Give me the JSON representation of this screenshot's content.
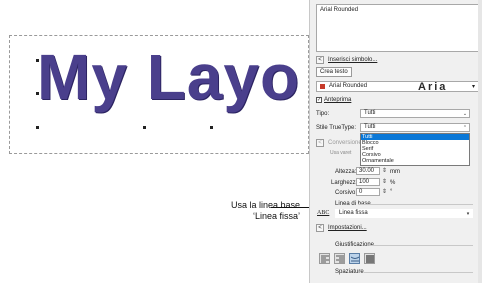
{
  "canvas": {
    "design_text": "My Layo"
  },
  "callout": {
    "line1": "Usa la linea base",
    "line2": "‘Linea fissa’"
  },
  "panel": {
    "text_value": "Arial Rounded",
    "insert_symbol": "Inserisci simbolo...",
    "create_text": "Crea testo",
    "font_name": "Arial Rounded",
    "font_preview": "Aria",
    "preview_label": "Anteprima",
    "type_label": "Tipo:",
    "type_value": "Tutti",
    "truetype_label": "Stile TrueType:",
    "truetype_value": "Tutti",
    "truetype_options": [
      "Tutti",
      "Blocco",
      "Serif",
      "Corsivo",
      "Ornamentale"
    ],
    "conversion_label": "Conversione",
    "hidden_label": "Usa varet",
    "height_label": "Altezza:",
    "height_value": "30.00",
    "height_unit": "mm",
    "width_label": "Larghezza:",
    "width_value": "100",
    "width_unit": "%",
    "slant_label": "Corsivo:",
    "slant_value": "0",
    "slant_unit": "°",
    "baseline_section": "Linea di base",
    "baseline_icon_text": "ABC",
    "baseline_value": "Linea fissa",
    "settings_label": "Impostazioni...",
    "justification_section": "Giustificazione",
    "spacing_section": "Spaziature"
  }
}
